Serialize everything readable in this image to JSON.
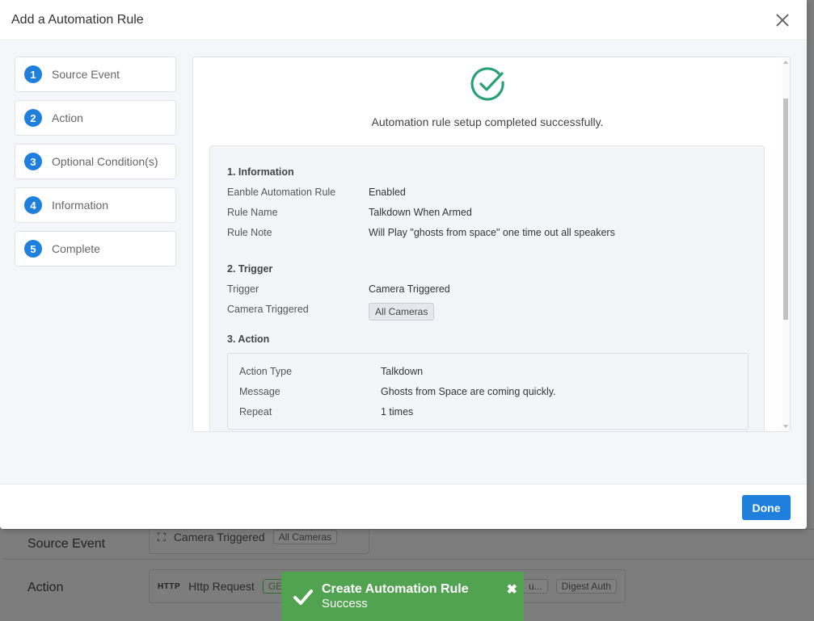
{
  "modal": {
    "title": "Add a Automation Rule",
    "done_label": "Done"
  },
  "steps": [
    {
      "num": "1",
      "label": "Source Event"
    },
    {
      "num": "2",
      "label": "Action"
    },
    {
      "num": "3",
      "label": "Optional Condition(s)"
    },
    {
      "num": "4",
      "label": "Information"
    },
    {
      "num": "5",
      "label": "Complete"
    }
  ],
  "result": {
    "message": "Automation rule setup completed successfully.",
    "accent_color": "#27a174"
  },
  "summary": {
    "information": {
      "title": "1. Information",
      "rows": [
        {
          "key": "Eanble Automation Rule",
          "value": "Enabled"
        },
        {
          "key": "Rule Name",
          "value": "Talkdown When Armed"
        },
        {
          "key": "Rule Note",
          "value": "Will Play \"ghosts from space\" one time out all speakers"
        }
      ]
    },
    "trigger": {
      "title": "2. Trigger",
      "trigger_key": "Trigger",
      "trigger_value": "Camera Triggered",
      "camera_key": "Camera Triggered",
      "camera_tag": "All Cameras"
    },
    "action": {
      "title": "3. Action",
      "rows": [
        {
          "key": "Action Type",
          "value": "Talkdown"
        },
        {
          "key": "Message",
          "value": "Ghosts from Space are coming quickly."
        },
        {
          "key": "Repeat",
          "value": "1 times"
        }
      ]
    }
  },
  "background": {
    "source_event_label": "Source Event",
    "source_event_value": "Camera Triggered",
    "source_event_tag": "All Cameras",
    "action_label": "Action",
    "action_icon_text": "HTTP",
    "action_value": "Http Request",
    "action_tag_1": "GE",
    "action_tag_2": "u...",
    "action_tag_3": "Digest Auth"
  },
  "toast": {
    "title": "Create Automation Rule",
    "subtitle": "Success",
    "color": "#51a351"
  }
}
